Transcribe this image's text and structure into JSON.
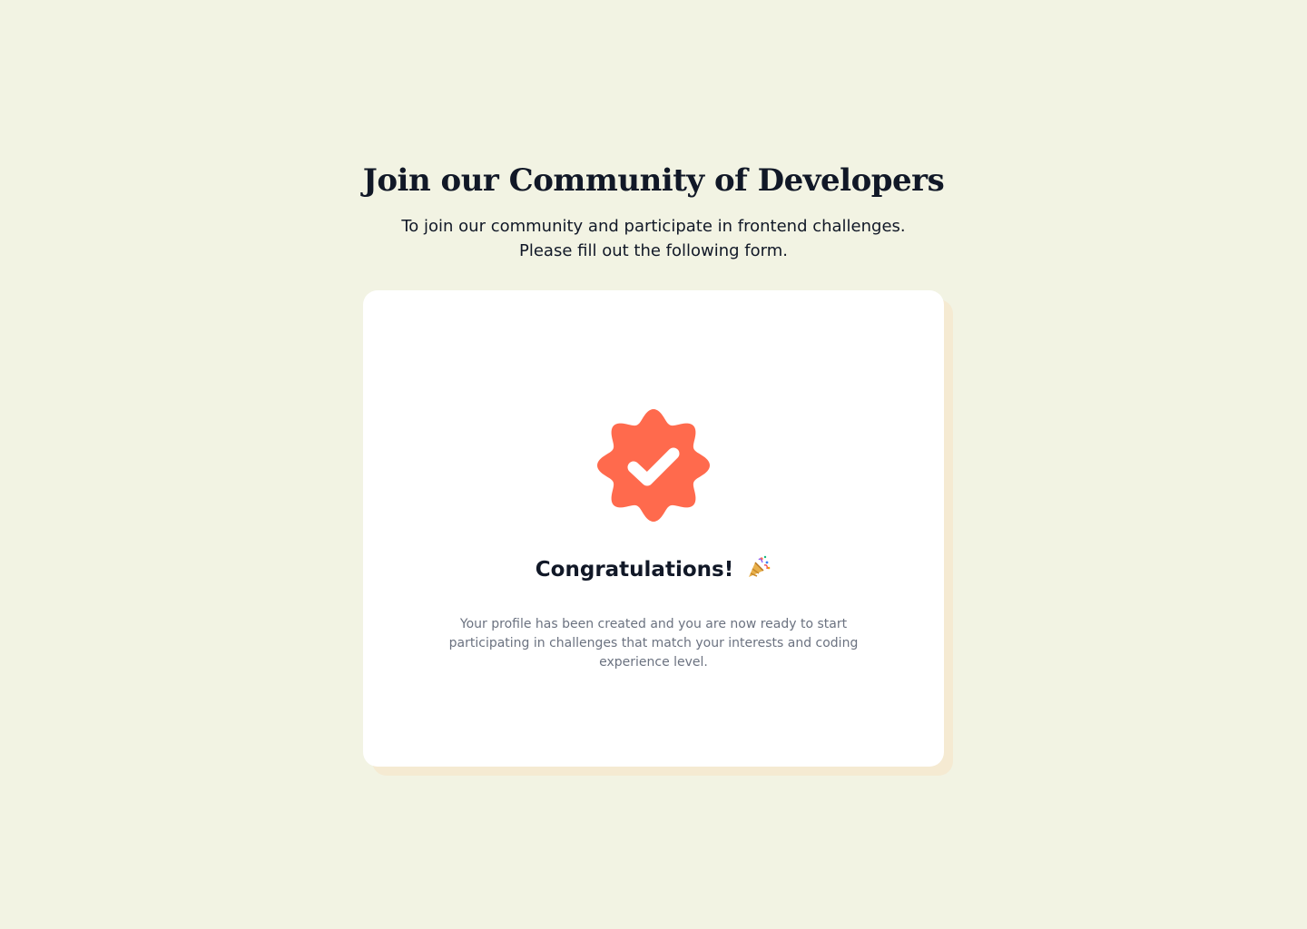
{
  "header": {
    "title": "Join our Community of Developers",
    "subtitle_line1": "To join our community and participate in frontend challenges.",
    "subtitle_line2": "Please fill out the following form."
  },
  "success_card": {
    "badge_icon": "verified-badge-check-icon",
    "heading": "Congratulations!",
    "heading_emoji_icon": "party-popper-icon",
    "message": "Your profile has been created and you are now ready to start participating in challenges that match your interests and coding experience level."
  },
  "colors": {
    "background": "#f2f3e3",
    "accent": "#ff6a4d",
    "card": "#ffffff",
    "card_shadow": "#f5ead2",
    "heading_text": "#111827",
    "body_text": "#6b7280"
  }
}
